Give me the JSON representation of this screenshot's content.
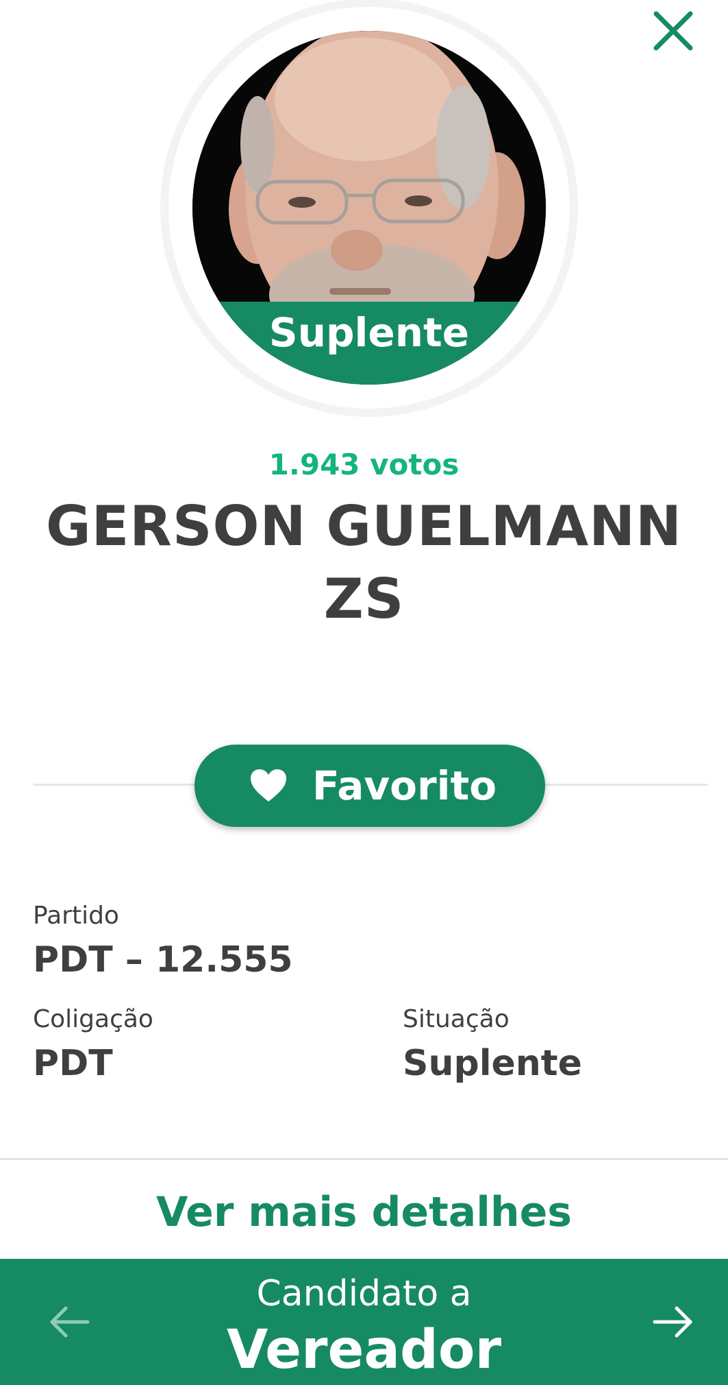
{
  "colors": {
    "primary": "#168a63",
    "votes": "#14b47d",
    "text": "#3f3f3f"
  },
  "header": {
    "close_icon": "close-icon"
  },
  "candidate": {
    "photo_icon": "candidate-photo",
    "badge": "Suplente",
    "votes": "1.943 votos",
    "name_line1": "GERSON GUELMANN",
    "name_line2": "ZS"
  },
  "favorite": {
    "icon": "heart-icon",
    "label": "Favorito"
  },
  "info": {
    "partido_label": "Partido",
    "partido_value": "PDT – 12.555",
    "coligacao_label": "Coligação",
    "coligacao_value": "PDT",
    "situacao_label": "Situação",
    "situacao_value": "Suplente"
  },
  "details_link": "Ver mais detalhes",
  "footer": {
    "prefix": "Candidato a",
    "office": "Vereador",
    "prev_icon": "arrow-left-icon",
    "next_icon": "arrow-right-icon"
  }
}
